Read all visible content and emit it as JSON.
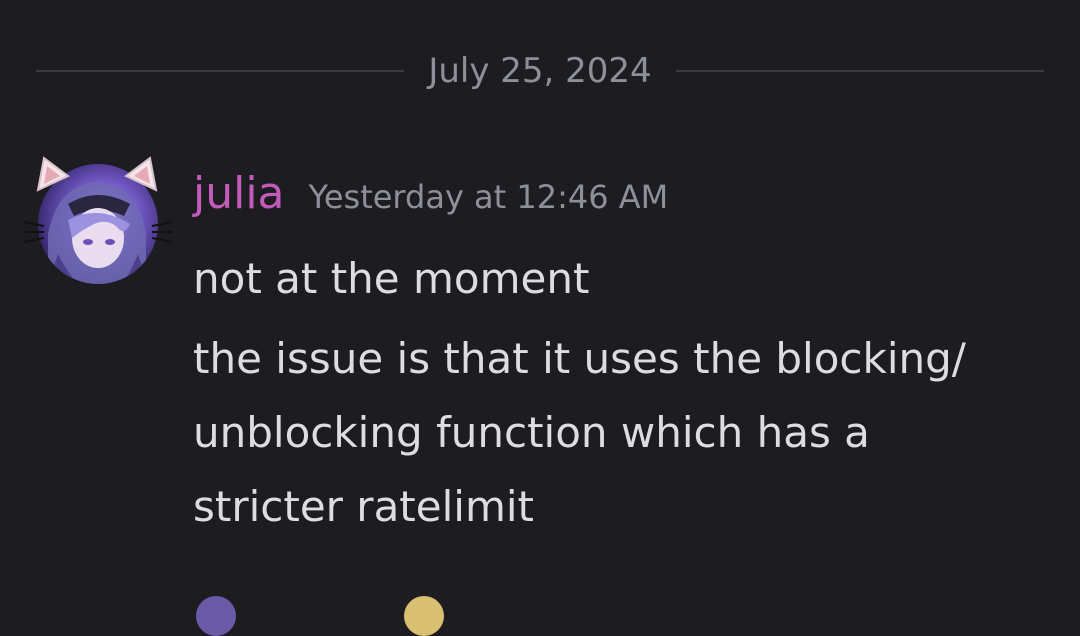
{
  "date_divider": {
    "label": "July 25, 2024"
  },
  "message": {
    "username": "julia",
    "username_color": "#c25bb9",
    "timestamp": "Yesterday at 12:46 AM",
    "lines": [
      "not at the moment",
      "the issue is that it uses the blocking/",
      "unblocking function which has a",
      "stricter ratelimit"
    ]
  },
  "colors": {
    "background": "#1c1c21",
    "divider": "#3a3b42",
    "muted_text": "#8e9099",
    "body_text": "#dcdde1"
  },
  "icons": {
    "avatar_decoration": "cat-ears-icon"
  }
}
